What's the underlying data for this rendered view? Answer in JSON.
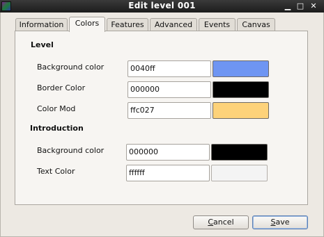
{
  "window": {
    "title": "Edit level 001",
    "min_glyph": "▁",
    "max_glyph": "□",
    "close_glyph": "✕"
  },
  "tabs": [
    {
      "label": "Information",
      "active": false
    },
    {
      "label": "Colors",
      "active": true
    },
    {
      "label": "Features",
      "active": false
    },
    {
      "label": "Advanced",
      "active": false
    },
    {
      "label": "Events",
      "active": false
    },
    {
      "label": "Canvas",
      "active": false
    }
  ],
  "level": {
    "heading": "Level",
    "background_color": {
      "label": "Background color",
      "value": "0040ff",
      "swatch": "#6e95f2"
    },
    "border_color": {
      "label": "Border Color",
      "value": "000000",
      "swatch": "#000000"
    },
    "color_mod": {
      "label": "Color Mod",
      "value": "ffc027",
      "swatch": "#fdd27a"
    }
  },
  "introduction": {
    "heading": "Introduction",
    "background_color": {
      "label": "Background color",
      "value": "000000",
      "swatch": "#000000"
    },
    "text_color": {
      "label": "Text Color",
      "value": "ffffff",
      "swatch": "#f4f4f4"
    }
  },
  "buttons": {
    "cancel_first": "C",
    "cancel_rest": "ancel",
    "save_first": "S",
    "save_rest": "ave"
  }
}
